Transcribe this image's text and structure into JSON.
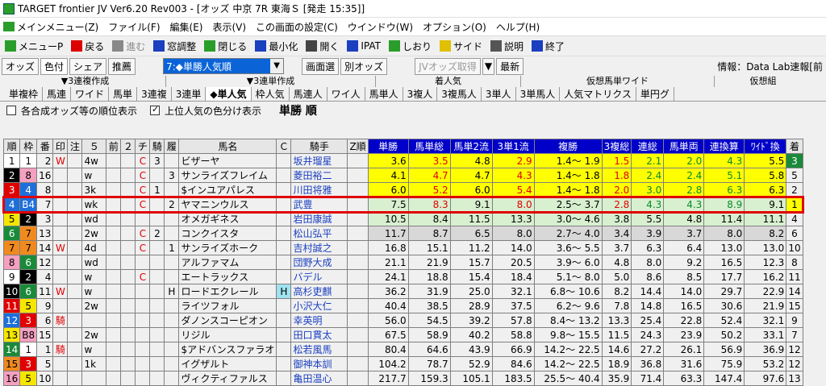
{
  "window": {
    "title": "TARGET frontier JV  Ver6.20  Rev003 - [オッズ 中京 7R 東海Ｓ  [発走 15:35]]"
  },
  "menu": [
    "メインメニュー(Z)",
    "ファイル(F)",
    "編集(E)",
    "表示(V)",
    "この画面の設定(C)",
    "ウインドウ(W)",
    "オプション(O)",
    "ヘルプ(H)"
  ],
  "toolbar": [
    "メニューP",
    "戻る",
    "進む",
    "窓調整",
    "閉じる",
    "最小化",
    "開く",
    "IPAT",
    "しおり",
    "サイド",
    "説明",
    "終了"
  ],
  "row2": {
    "btns": [
      "オッズ",
      "色付",
      "シェア",
      "推薦"
    ],
    "select": "7:◆単勝人気順",
    "btns2": [
      "画面選",
      "別オッズ"
    ],
    "jv": "JVオッズ取得",
    "latest": "最新",
    "info": "情報：Data Lab速報[前"
  },
  "tabs_top": [
    "▼3連複作成",
    "▼3連単作成",
    "着人気",
    "仮想馬単ワイド",
    "仮想組"
  ],
  "tabs": [
    "単複枠",
    "馬連",
    "ワイド",
    "馬単",
    "3連複",
    "3連単",
    "◆単人気",
    "枠人気",
    "馬連人",
    "ワイ人",
    "馬単人",
    "3複人",
    "3複馬人",
    "3単人",
    "3単馬人",
    "人気マトリクス",
    "単円グ"
  ],
  "options": {
    "opt1": "各合成オッズ等の順位表示",
    "opt2": "上位人気の色分け表示",
    "heading": "単勝 順"
  },
  "headers": [
    "順",
    "枠",
    "番",
    "印",
    "注",
    "５",
    "前",
    "２",
    "チ",
    "騎",
    "履",
    "馬名",
    "Ｃ",
    "騎手",
    "Z順",
    "単勝",
    "馬単総",
    "馬単2流",
    "3単1流",
    "複勝",
    "3複総",
    "連総",
    "馬単両",
    "連換算",
    "ﾜｲﾄﾞ換",
    "着"
  ],
  "rows": [
    {
      "r": "1",
      "w": "1",
      "n": "2",
      "m": "W",
      "f": "4w",
      "ch": "C",
      "k": "3",
      "name": "ビザーヤ",
      "j": "坂井瑠星",
      "t": "3.6",
      "a": "3.5",
      "b": "4.8",
      "c": "2.9",
      "p": "1.4～ 1.9",
      "d": "1.5",
      "e": "2.1",
      "g": "2.0",
      "h": "4.3",
      "i": "5.5",
      "z": "3"
    },
    {
      "r": "2",
      "w": "8",
      "n": "16",
      "f": "w",
      "ch": "C",
      "k": "",
      "rk": "3",
      "name": "サンライズフレイム",
      "j": "菱田裕二",
      "t": "4.1",
      "a": "4.7",
      "b": "4.7",
      "c": "4.3",
      "p": "1.4～ 1.8",
      "d": "1.8",
      "e": "2.4",
      "g": "2.4",
      "h": "5.1",
      "i": "5.8",
      "z": "5"
    },
    {
      "r": "3",
      "w": "4",
      "n": "8",
      "f": "3k",
      "ch": "C",
      "k": "1",
      "name": "$インユアパレス",
      "j": "川田将雅",
      "t": "6.0",
      "a": "5.2",
      "b": "6.0",
      "c": "5.4",
      "p": "1.4～ 1.8",
      "d": "2.0",
      "e": "3.0",
      "g": "2.8",
      "h": "6.3",
      "i": "6.3",
      "z": "2"
    },
    {
      "r": "4",
      "w": "B4",
      "n": "7",
      "f": "wk",
      "ch": "C",
      "k": "",
      "rk": "2",
      "name": "ヤマニンウルス",
      "j": "武豊",
      "t": "7.5",
      "a": "8.3",
      "b": "9.1",
      "c": "8.0",
      "p": "2.5～ 3.7",
      "d": "2.8",
      "e": "4.3",
      "g": "4.3",
      "h": "8.9",
      "i": "9.1",
      "z": "1"
    },
    {
      "r": "5",
      "w": "2",
      "n": "3",
      "f": "wd",
      "name": "オメガギネス",
      "j": "岩田康誠",
      "t": "10.5",
      "a": "8.4",
      "b": "11.5",
      "c": "13.3",
      "p": "3.0～ 4.6",
      "d": "3.8",
      "e": "5.5",
      "g": "4.8",
      "h": "11.4",
      "i": "11.1",
      "z": "4"
    },
    {
      "r": "6",
      "w": "7",
      "n": "13",
      "f": "2w",
      "ch": "C",
      "k": "2",
      "name": "コンクイスタ",
      "j": "松山弘平",
      "t": "11.7",
      "a": "8.7",
      "b": "6.5",
      "c": "8.0",
      "p": "2.7～ 4.0",
      "d": "3.4",
      "e": "3.9",
      "g": "3.7",
      "h": "8.0",
      "i": "8.2",
      "z": "6"
    },
    {
      "r": "7",
      "w": "7",
      "n": "14",
      "m": "W",
      "f": "4d",
      "ch": "C",
      "rk": "1",
      "name": "サンライズホーク",
      "j": "吉村誠之",
      "t": "16.8",
      "a": "15.1",
      "b": "11.2",
      "c": "14.0",
      "p": "3.6～ 5.5",
      "d": "3.7",
      "e": "6.3",
      "g": "6.4",
      "h": "13.0",
      "i": "13.0",
      "z": "10"
    },
    {
      "r": "8",
      "w": "6",
      "n": "12",
      "f": "wd",
      "name": "アルファマム",
      "j": "団野大成",
      "t": "21.1",
      "a": "21.9",
      "b": "15.7",
      "c": "20.5",
      "p": "3.9～ 6.0",
      "d": "4.8",
      "e": "8.0",
      "g": "9.2",
      "h": "16.5",
      "i": "12.3",
      "z": "8"
    },
    {
      "r": "9",
      "w": "2",
      "n": "4",
      "f": "w",
      "ch": "C",
      "name": "エートラックス",
      "j": "バデル",
      "t": "24.1",
      "a": "18.8",
      "b": "15.4",
      "c": "18.4",
      "p": "5.1～ 8.0",
      "d": "5.0",
      "e": "8.6",
      "g": "8.5",
      "h": "17.7",
      "i": "16.2",
      "z": "11"
    },
    {
      "r": "10",
      "w": "6",
      "n": "11",
      "m": "W",
      "f": "w",
      "h2": "H",
      "name": "ロードエクレール",
      "bl": "H",
      "j": "高杉吏麒",
      "t": "36.2",
      "a": "31.9",
      "b": "25.0",
      "c": "32.1",
      "p": "6.8～ 10.6",
      "d": "8.2",
      "e": "14.4",
      "g": "14.0",
      "h": "29.7",
      "i": "22.9",
      "z": "14"
    },
    {
      "r": "11",
      "w": "5",
      "n": "9",
      "f": "2w",
      "name": "ライツフォル",
      "j": "小沢大仁",
      "t": "40.4",
      "a": "38.5",
      "b": "28.9",
      "c": "37.5",
      "p": "6.2～ 9.6",
      "d": "7.8",
      "e": "14.8",
      "g": "16.5",
      "h": "30.6",
      "i": "21.9",
      "z": "15"
    },
    {
      "r": "12",
      "w": "3",
      "n": "6",
      "m": "騎",
      "name": "ダノンスコーピオン",
      "j": "幸英明",
      "t": "56.0",
      "a": "54.5",
      "b": "39.2",
      "c": "57.8",
      "p": "8.4～ 13.2",
      "d": "13.3",
      "e": "25.4",
      "g": "22.8",
      "h": "52.4",
      "i": "32.1",
      "z": "9"
    },
    {
      "r": "13",
      "w": "B8",
      "n": "15",
      "f": "2w",
      "name": "リジル",
      "j": "田口貫太",
      "t": "67.5",
      "a": "58.9",
      "b": "40.2",
      "c": "58.8",
      "p": "9.8～ 15.5",
      "d": "11.5",
      "e": "24.3",
      "g": "23.9",
      "h": "50.2",
      "i": "33.1",
      "z": "7"
    },
    {
      "r": "14",
      "w": "1",
      "n": "1",
      "m": "騎",
      "f": "w",
      "name": "$アドバンスファラオ",
      "j": "松若風馬",
      "t": "80.4",
      "a": "64.6",
      "b": "43.9",
      "c": "66.9",
      "p": "14.2～ 22.5",
      "d": "14.6",
      "e": "27.2",
      "g": "26.1",
      "h": "56.9",
      "i": "36.9",
      "z": "12"
    },
    {
      "r": "15",
      "w": "3",
      "n": "5",
      "f": "1k",
      "name": "イグザルト",
      "j": "御神本訓",
      "t": "104.2",
      "a": "78.7",
      "b": "52.9",
      "c": "84.6",
      "p": "14.2～ 22.5",
      "d": "18.9",
      "e": "36.8",
      "g": "31.6",
      "h": "75.9",
      "i": "53.2",
      "z": "12"
    },
    {
      "r": "16",
      "w": "5",
      "n": "10",
      "name": "ヴィクティファルス",
      "j": "亀田温心",
      "t": "217.7",
      "a": "159.3",
      "b": "105.1",
      "c": "183.5",
      "p": "25.5～ 40.4",
      "d": "35.9",
      "e": "71.4",
      "g": "63.3",
      "h": "147.4",
      "i": "97.6",
      "z": "13"
    }
  ]
}
